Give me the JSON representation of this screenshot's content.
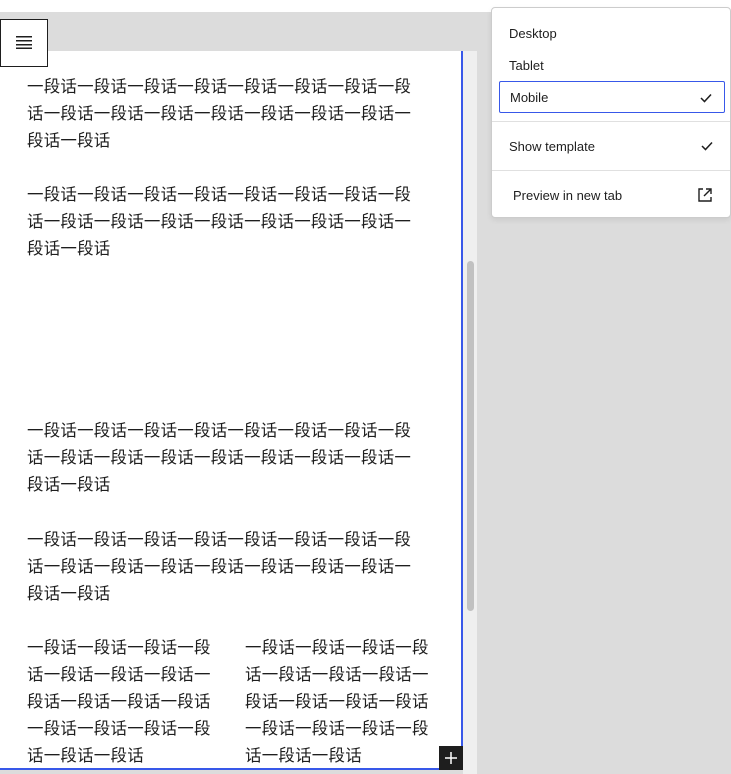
{
  "editor": {
    "paragraph_text": "一段话一段话一段话一段话一段话一段话一段话一段话一段话一段话一段话一段话一段话一段话一段话一段话一段话",
    "column_text": "一段话一段话一段话一段话一段话一段话一段话一段话一段话一段话一段话一段话一段话一段话一段话一段话一段话"
  },
  "preview_menu": {
    "items": [
      {
        "label": "Desktop",
        "selected": false
      },
      {
        "label": "Tablet",
        "selected": false
      },
      {
        "label": "Mobile",
        "selected": true
      }
    ],
    "show_template": "Show template",
    "show_template_checked": true,
    "preview_new_tab": "Preview in new tab"
  },
  "colors": {
    "accent": "#3858e9",
    "text": "#1e1e1e",
    "canvas_background": "#dcdcdc"
  },
  "icons": [
    "list-view-icon",
    "check-icon",
    "external-link-icon",
    "plus-icon"
  ]
}
